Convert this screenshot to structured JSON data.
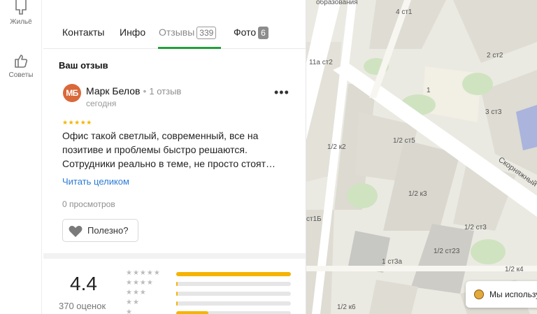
{
  "rail": {
    "items": [
      {
        "label": "Жильё",
        "icon": "building-icon"
      },
      {
        "label": "Советы",
        "icon": "thumbs-up-icon"
      }
    ]
  },
  "tabs": [
    {
      "label": "Контакты"
    },
    {
      "label": "Инфо"
    },
    {
      "label": "Отзывы",
      "count": "339"
    },
    {
      "label": "Фото",
      "count": "6"
    }
  ],
  "review": {
    "section_title": "Ваш отзыв",
    "avatar_initials": "МБ",
    "author": "Марк Белов",
    "author_reviews": "1 отзыв",
    "date": "сегодня",
    "rating": 5,
    "text": "Офис такой светлый, современный, все на позитиве и проблемы быстро решаются. Сотрудники реально в теме, не просто стоят…",
    "read_more": "Читать целиком",
    "views": "0 просмотров",
    "useful_label": "Полезно?"
  },
  "summary": {
    "rating": "4.4",
    "count": "370 оценок",
    "distribution": [
      {
        "stars": 5,
        "fraction": 1.0
      },
      {
        "stars": 4,
        "fraction": 0.01
      },
      {
        "stars": 3,
        "fraction": 0.01
      },
      {
        "stars": 2,
        "fraction": 0.01
      },
      {
        "stars": 1,
        "fraction": 0.28
      }
    ]
  },
  "map": {
    "labels": [
      "образования",
      "4 ст1",
      "2 ст2",
      "11а ст2",
      "1",
      "3 ст3",
      "1/2 к2",
      "1/2 ст5",
      "Скорняжный",
      "1/2 к3",
      "1/2 ст3",
      "ст1Б",
      "1/2 ст23",
      "1 ст3а",
      "1/2 к4",
      "1/2 к6"
    ]
  },
  "cookie_banner": {
    "text": "Мы использу"
  },
  "colors": {
    "accent": "#21a038",
    "star": "#f5b400",
    "link": "#2b7bd6",
    "avatar": "#d9683a"
  }
}
